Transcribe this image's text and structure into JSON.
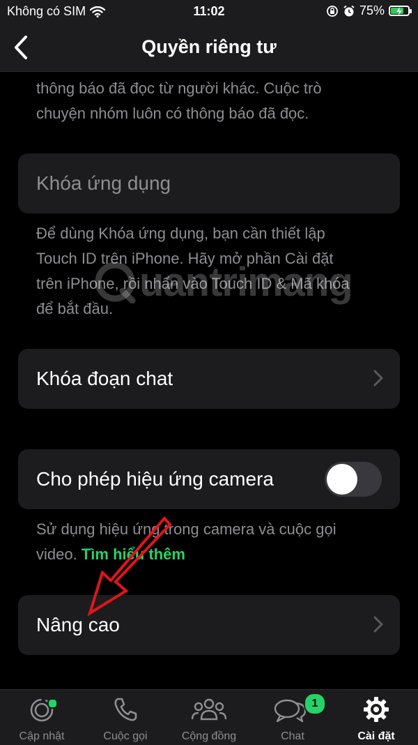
{
  "status_bar": {
    "carrier": "Không có SIM",
    "time": "11:02",
    "battery_percent": "75%",
    "battery_level": 0.75,
    "icons": [
      "wifi-icon",
      "orientation-lock-icon",
      "alarm-icon",
      "battery-charging-icon"
    ]
  },
  "nav": {
    "title": "Quyền riêng tư",
    "back_icon": "chevron-left-icon"
  },
  "sections": {
    "read_receipts_desc": {
      "line1": "thông báo đã đọc từ người khác. Cuộc trò",
      "line2": "chuyện nhóm luôn có thông báo đã đọc."
    },
    "app_lock": {
      "label": "Khóa ứng dụng",
      "desc_line1": "Để dùng Khóa ứng dụng, bạn cần thiết lập",
      "desc_line2": "Touch ID trên iPhone. Hãy mở phần Cài đặt",
      "desc_line3": "trên iPhone, rồi nhấn vào Touch ID & Mã khóa",
      "desc_line4": "để bắt đầu."
    },
    "chat_lock": {
      "label": "Khóa đoạn chat"
    },
    "camera_effects": {
      "label": "Cho phép hiệu ứng camera",
      "toggle_on": false,
      "desc_line1": "Sử dụng hiệu ứng trong camera và cuộc gọi",
      "desc_line2": "video.",
      "link": "Tìm hiểu thêm"
    },
    "advanced": {
      "label": "Nâng cao"
    }
  },
  "watermark": "uantrimang",
  "tabs": [
    {
      "label": "Cập nhật",
      "icon": "updates-icon",
      "active": false
    },
    {
      "label": "Cuộc gọi",
      "icon": "phone-icon",
      "active": false
    },
    {
      "label": "Cộng đồng",
      "icon": "community-icon",
      "active": false
    },
    {
      "label": "Chat",
      "icon": "chat-bubbles-icon",
      "active": false,
      "badge": "1"
    },
    {
      "label": "Cài đặt",
      "icon": "settings-gear-icon",
      "active": true
    }
  ],
  "colors": {
    "background": "#000000",
    "card": "#1c1c1e",
    "secondary_text": "#8e8e93",
    "accent_green": "#25d366",
    "annotation_red": "#e0151b"
  }
}
